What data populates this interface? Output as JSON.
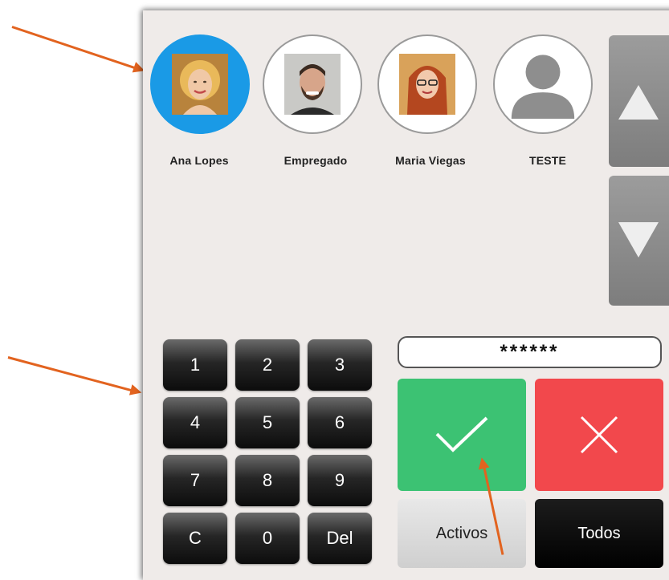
{
  "users": [
    {
      "name": "Ana Lopes",
      "selected": true,
      "icon": "user-photo-icon"
    },
    {
      "name": "Empregado",
      "selected": false,
      "icon": "user-photo-icon"
    },
    {
      "name": "Maria Viegas",
      "selected": false,
      "icon": "user-photo-icon"
    },
    {
      "name": "TESTE",
      "selected": false,
      "icon": "generic-user-icon"
    }
  ],
  "scroll": {
    "up_icon": "triangle-up-icon",
    "down_icon": "triangle-down-icon"
  },
  "keypad": {
    "keys": [
      "1",
      "2",
      "3",
      "4",
      "5",
      "6",
      "7",
      "8",
      "9",
      "C",
      "0",
      "Del"
    ]
  },
  "password": {
    "value": "******"
  },
  "actions": {
    "confirm_icon": "checkmark-icon",
    "cancel_icon": "x-icon",
    "activos_label": "Activos",
    "todos_label": "Todos"
  },
  "colors": {
    "selected": "#1a9ae6",
    "confirm": "#3cc273",
    "cancel": "#f2484c",
    "annotation": "#e2631f"
  }
}
